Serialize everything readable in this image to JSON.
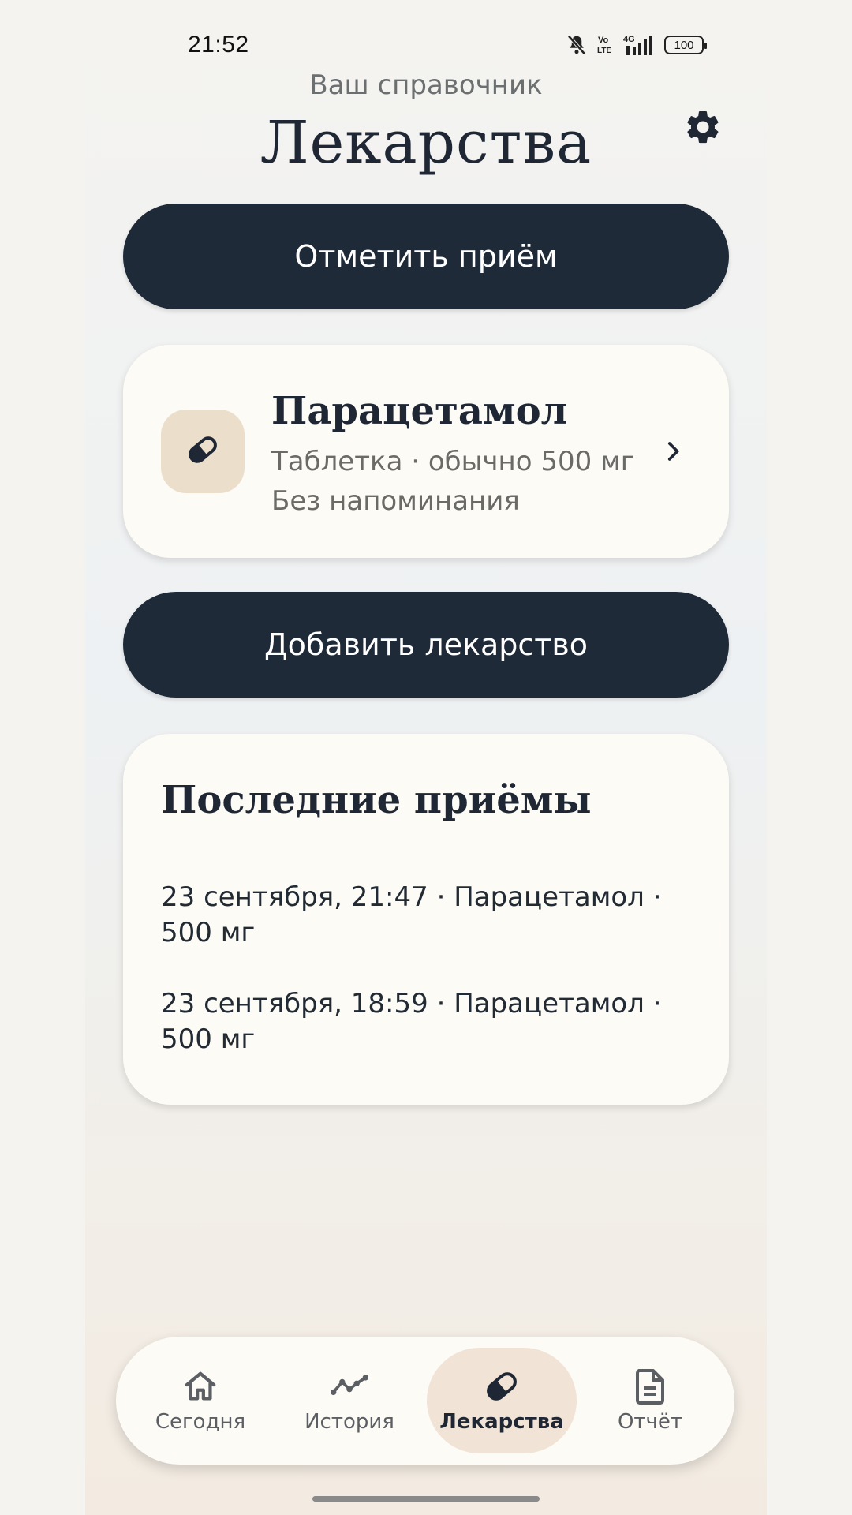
{
  "status_bar": {
    "time": "21:52",
    "network": "4G",
    "volte": "Vo LTE",
    "battery": "100"
  },
  "header": {
    "subtitle": "Ваш справочник",
    "title": "Лекарства",
    "settings_icon": "gear-icon"
  },
  "actions": {
    "log_intake_label": "Отметить приём",
    "add_medication_label": "Добавить лекарство"
  },
  "medications": [
    {
      "name": "Парацетамол",
      "description": "Таблетка · обычно 500 мг",
      "reminder": "Без напоминания",
      "icon": "pill-icon"
    }
  ],
  "recent": {
    "title": "Последние приёмы",
    "items": [
      "23 сентября, 21:47 · Парацетамол · 500 мг",
      "23 сентября, 18:59 · Парацетамол · 500 мг"
    ]
  },
  "nav": {
    "items": [
      {
        "label": "Сегодня",
        "icon": "home-icon",
        "active": false
      },
      {
        "label": "История",
        "icon": "trend-icon",
        "active": false
      },
      {
        "label": "Лекарства",
        "icon": "pill-icon",
        "active": true
      },
      {
        "label": "Отчёт",
        "icon": "document-icon",
        "active": false
      }
    ]
  },
  "colors": {
    "primary_dark": "#1f2a38",
    "card_background": "#fdfbf6",
    "accent_beige": "#ebdfcc",
    "active_tab": "#f1e4d6"
  }
}
